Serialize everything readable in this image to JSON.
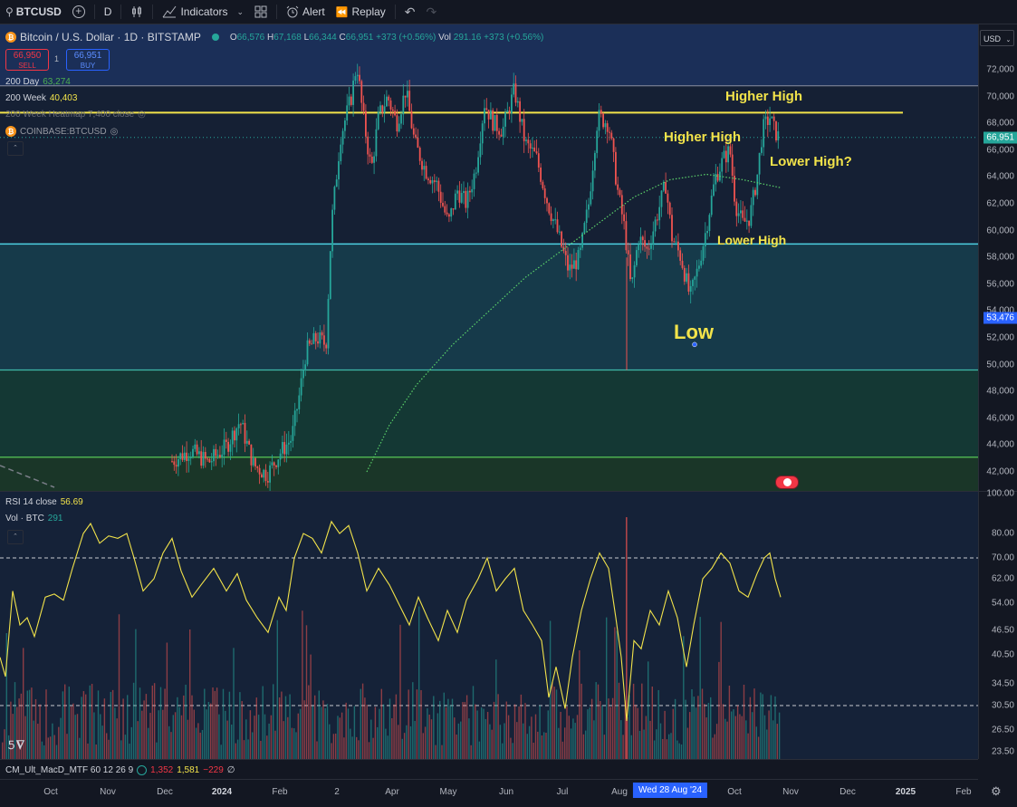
{
  "toolbar": {
    "symbol": "BTCUSD",
    "interval": "D",
    "indicators_label": "Indicators",
    "alert_label": "Alert",
    "replay_label": "Replay"
  },
  "legend": {
    "title": "Bitcoin / U.S. Dollar · 1D · BITSTAMP",
    "o_label": "O",
    "o_value": "66,576",
    "h_label": "H",
    "h_value": "67,168",
    "l_label": "L",
    "l_value": "66,344",
    "c_label": "C",
    "c_value": "66,951",
    "change": "+373 (+0.56%)",
    "vol_label": "Vol",
    "vol_value": "291.16",
    "vol_change": "+373 (+0.56%)",
    "sell_price": "66,950",
    "sell_label": "SELL",
    "spread": "1",
    "buy_price": "66,951",
    "buy_label": "BUY",
    "ma200d_label": "200 Day",
    "ma200d_value": "63,274",
    "ma200w_label": "200 Week",
    "ma200w_value": "40,403",
    "heatmap_label": "200 Week Heatmap 7,400 close",
    "compare_label": "COINBASE:BTCUSD",
    "currency": "USD"
  },
  "annotations": {
    "higher_high_1": "Higher High",
    "higher_high_2": "Higher High",
    "lower_high_q": "Lower High?",
    "lower_high": "Lower High",
    "low": "Low"
  },
  "price_axis": [
    "72,000",
    "70,000",
    "68,000",
    "66,000",
    "64,000",
    "62,000",
    "60,000",
    "58,000",
    "56,000",
    "54,000",
    "52,000",
    "50,000",
    "48,000",
    "46,000",
    "44,000",
    "42,000"
  ],
  "price_tags": {
    "last": "66,951",
    "crosshair": "53,476"
  },
  "rsi": {
    "label": "RSI 14 close",
    "value": "56.69"
  },
  "vol": {
    "label": "Vol · BTC",
    "value": "291"
  },
  "rsi_axis": [
    "100.00",
    "80.00",
    "70.00",
    "62.00",
    "54.00",
    "46.50",
    "40.50",
    "34.50",
    "30.50",
    "26.50",
    "23.50"
  ],
  "macd": {
    "label": "CM_Ult_MacD_MTF 60 12 26 9",
    "v1": "1,352",
    "v2": "1,581",
    "v3": "−229",
    "c1": "#f23645",
    "c2": "#f2e34a",
    "c3": "#f23645"
  },
  "time_axis": [
    "Oct",
    "Nov",
    "Dec",
    "2024",
    "Feb",
    "2",
    "Apr",
    "May",
    "Jun",
    "Jul",
    "Aug",
    "Wed 28 Aug '24",
    "Oct",
    "Nov",
    "Dec",
    "2025",
    "Feb"
  ],
  "colors": {
    "up": "#26a69a",
    "down": "#ef5350",
    "yellow": "#f2e34a",
    "cyan": "#4dd0e1",
    "green": "#4caf50",
    "band1": "#1e3a5f"
  }
}
